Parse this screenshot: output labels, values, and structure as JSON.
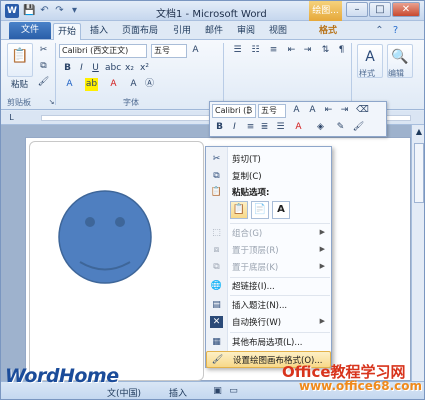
{
  "app": {
    "title": "文档1 - Microsoft Word",
    "context_tab_group": "绘图...",
    "word_icon": "W"
  },
  "tabs": {
    "file": "文件",
    "items": [
      "开始",
      "插入",
      "页面布局",
      "引用",
      "邮件",
      "审阅",
      "视图"
    ],
    "context": "格式"
  },
  "ribbon": {
    "clipboard": {
      "paste": "粘贴",
      "label": "剪贴板"
    },
    "font": {
      "name": "Calibri (西文正文)",
      "size": "五号",
      "label": "字体"
    },
    "styles": {
      "label": "样式"
    },
    "editing": {
      "label": "编辑"
    }
  },
  "mini_toolbar": {
    "font": "Calibri (₿",
    "size": "五号"
  },
  "context_menu": {
    "items": [
      {
        "label": "剪切(T)",
        "icon": "scissors-icon",
        "disabled": false
      },
      {
        "label": "复制(C)",
        "icon": "copy-icon",
        "disabled": false
      },
      {
        "label": "粘贴选项:",
        "icon": "paste-icon",
        "disabled": false
      },
      {
        "label": "组合(G)",
        "icon": "group-icon",
        "disabled": true
      },
      {
        "label": "置于顶层(R)",
        "icon": "bring-front-icon",
        "disabled": true
      },
      {
        "label": "置于底层(K)",
        "icon": "send-back-icon",
        "disabled": true
      },
      {
        "label": "超链接(I)...",
        "icon": "hyperlink-icon",
        "disabled": false
      },
      {
        "label": "插入题注(N)...",
        "icon": "caption-icon",
        "disabled": false
      },
      {
        "label": "自动换行(W)",
        "icon": "wrap-icon",
        "disabled": false
      },
      {
        "label": "其他布局选项(L)...",
        "icon": "layout-icon",
        "disabled": false
      },
      {
        "label": "设置绘图画布格式(O)...",
        "icon": "format-canvas-icon",
        "disabled": false
      }
    ],
    "paste_option_letter": "A"
  },
  "status": {
    "language": "文(中国)",
    "mode": "插入"
  },
  "watermarks": {
    "left": "WordHome",
    "right": "Office教程学习网",
    "right_url": "www.office68.com"
  },
  "colors": {
    "accent": "#2a5ea8",
    "smiley_fill": "#4f7fc0",
    "smiley_stroke": "#3e6699",
    "highlight": "#f7d889"
  }
}
